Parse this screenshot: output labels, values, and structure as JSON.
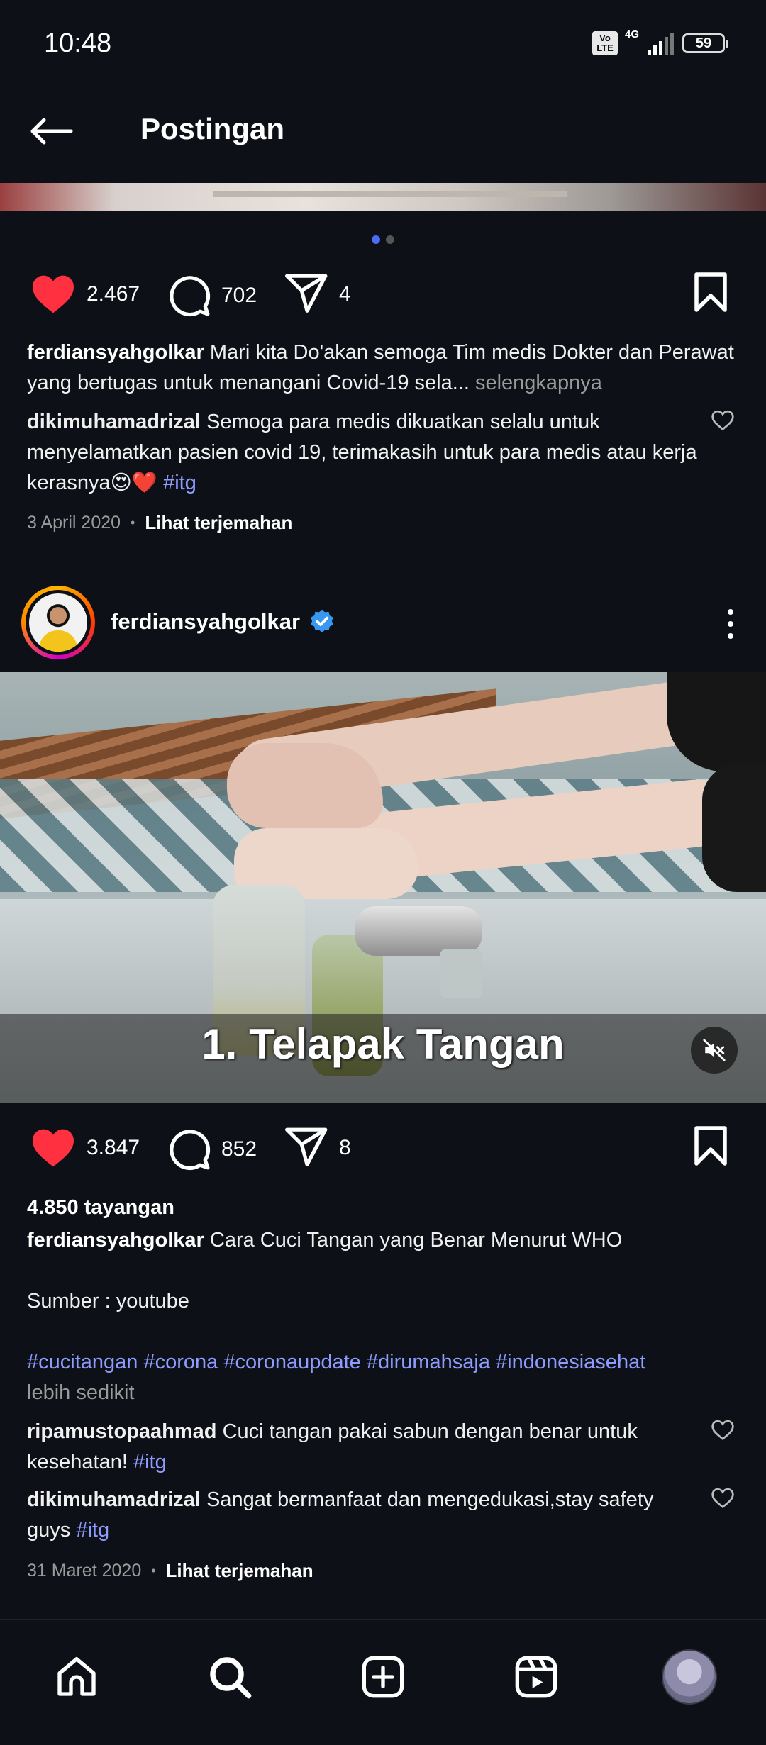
{
  "status_bar": {
    "time": "10:48",
    "volte": "Vo LTE",
    "network": "4G",
    "battery": "59"
  },
  "header": {
    "title": "Postingan"
  },
  "post1": {
    "likes": "2.467",
    "comments": "702",
    "shares": "4",
    "caption_user": "ferdiansyahgolkar",
    "caption_text": "Mari kita Do'akan semoga Tim medis Dokter dan Perawat  yang bertugas untuk menangani Covid-19 sela...",
    "see_more": "selengkapnya",
    "comment_user": "dikimuhamadrizal",
    "comment_text": "Semoga para medis dikuatkan selalu untuk menyelamatkan pasien covid 19, terimakasih untuk para medis atau kerja kerasnya😍❤️",
    "comment_hashtag": "#itg",
    "date": "3 April 2020",
    "translate": "Lihat terjemahan"
  },
  "post2": {
    "username": "ferdiansyahgolkar",
    "video_caption": "1. Telapak Tangan",
    "likes": "3.847",
    "comments": "852",
    "shares": "8",
    "views": "4.850 tayangan",
    "caption_user": "ferdiansyahgolkar",
    "caption_text": "Cara Cuci Tangan yang Benar Menurut WHO",
    "source": "Sumber : youtube",
    "hashtags": "#cucitangan #corona #coronaupdate #dirumahsaja #indonesiasehat",
    "less": "lebih sedikit",
    "comments_list": [
      {
        "user": "ripamustopaahmad",
        "text": "Cuci tangan pakai sabun dengan benar untuk kesehatan!",
        "hashtag": "#itg"
      },
      {
        "user": "dikimuhamadrizal",
        "text": "Sangat bermanfaat dan mengedukasi,stay safety guys",
        "hashtag": "#itg"
      }
    ],
    "date": "31 Maret 2020",
    "translate": "Lihat terjemahan"
  },
  "icons": {
    "back": "arrow-left-icon",
    "like": "heart-icon",
    "comment": "comment-icon",
    "share": "send-icon",
    "save": "bookmark-icon",
    "more": "more-vertical-icon",
    "mute": "mute-icon",
    "verified": "verified-badge-icon",
    "nav": [
      "home-icon",
      "search-icon",
      "add-post-icon",
      "reels-icon",
      "profile-avatar"
    ]
  },
  "colors": {
    "background": "#0d1117",
    "like": "#ff3040",
    "hashtag": "#8e9bff",
    "verified": "#3897f0",
    "active_dot": "#4a6cf7"
  }
}
